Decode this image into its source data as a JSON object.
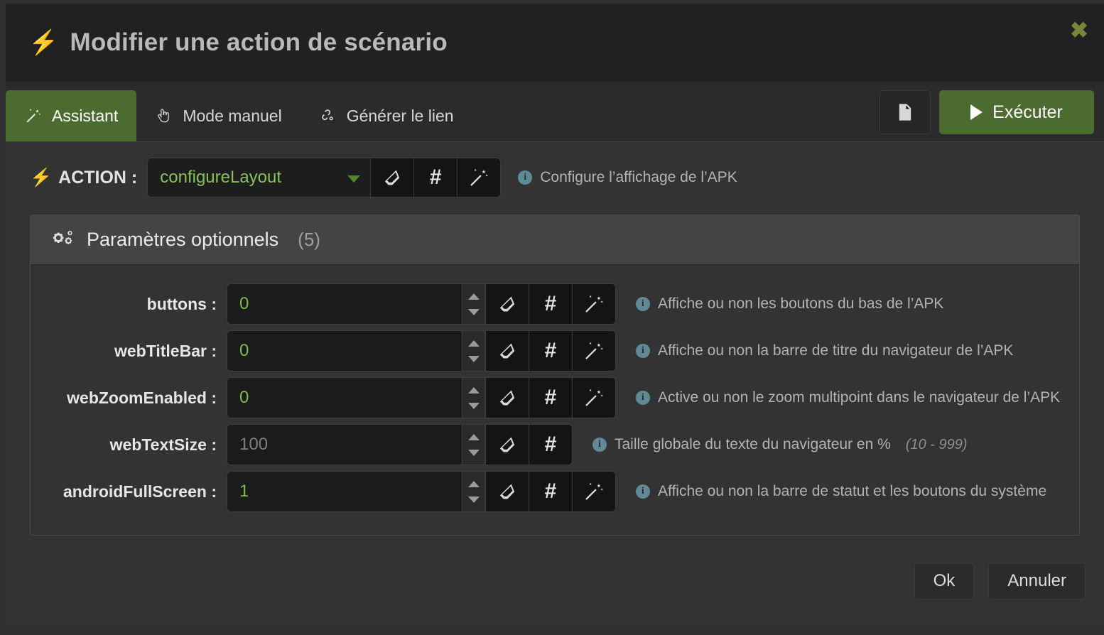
{
  "header": {
    "title": "Modifier une action de scénario",
    "bolt_icon": "bolt-icon",
    "close_label": "✖"
  },
  "tabs": [
    {
      "label": "Assistant",
      "icon": "magic-wand-icon",
      "active": true
    },
    {
      "label": "Mode manuel",
      "icon": "hand-pointer-icon",
      "active": false
    },
    {
      "label": "Générer le lien",
      "icon": "link-chain-icon",
      "active": false
    }
  ],
  "header_actions": {
    "doc_button_icon": "document-icon",
    "execute_label": "Exécuter"
  },
  "action": {
    "label": "ACTION :",
    "value": "configureLayout",
    "help": "Configure l’affichage de l’APK",
    "buttons": [
      "eraser-icon",
      "hash-icon",
      "magic-wand-icon"
    ]
  },
  "panel": {
    "title": "Paramètres optionnels",
    "count": "(5)",
    "icon": "gears-icon"
  },
  "params": [
    {
      "name": "buttons :",
      "value": "0",
      "placeholder": "",
      "is_placeholder": false,
      "help": "Affiche ou non les boutons du bas de l’APK",
      "range": "",
      "buttons": [
        "eraser-icon",
        "hash-icon",
        "magic-wand-icon"
      ]
    },
    {
      "name": "webTitleBar :",
      "value": "0",
      "placeholder": "",
      "is_placeholder": false,
      "help": "Affiche ou non la barre de titre du navigateur de l’APK",
      "range": "",
      "buttons": [
        "eraser-icon",
        "hash-icon",
        "magic-wand-icon"
      ]
    },
    {
      "name": "webZoomEnabled :",
      "value": "0",
      "placeholder": "",
      "is_placeholder": false,
      "help": "Active ou non le zoom multipoint dans le navigateur de l’APK",
      "range": "",
      "buttons": [
        "eraser-icon",
        "hash-icon",
        "magic-wand-icon"
      ]
    },
    {
      "name": "webTextSize :",
      "value": "",
      "placeholder": "100",
      "is_placeholder": true,
      "help": "Taille globale du texte du navigateur en %",
      "range": "(10 - 999)",
      "buttons": [
        "eraser-icon",
        "hash-icon"
      ]
    },
    {
      "name": "androidFullScreen :",
      "value": "1",
      "placeholder": "",
      "is_placeholder": false,
      "help": "Affiche ou non la barre de statut et les boutons du système",
      "range": "",
      "buttons": [
        "eraser-icon",
        "hash-icon",
        "magic-wand-icon"
      ]
    }
  ],
  "footer": {
    "ok_label": "Ok",
    "cancel_label": "Annuler"
  },
  "colors": {
    "accent_green": "#4b6b30",
    "value_green": "#7dbb4e",
    "info_blue": "#5f8a96",
    "close_olive": "#77883a",
    "modal_bg": "#333333",
    "header_bg": "#212121"
  }
}
